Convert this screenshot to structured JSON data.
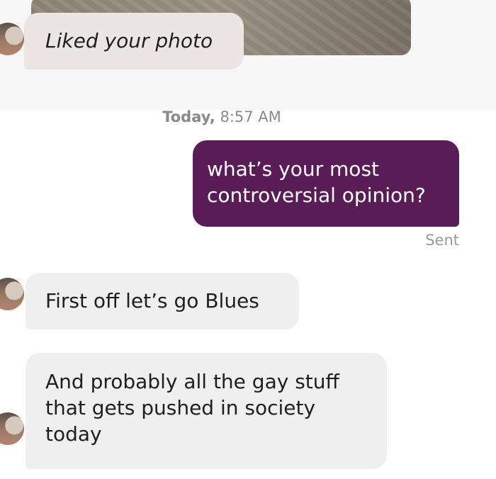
{
  "conversation": {
    "liked_message": "Liked your photo",
    "timestamp": {
      "day": "Today,",
      "time": "8:57 AM"
    },
    "outgoing": {
      "lines": [
        "what’s your most",
        "controversial opinion?"
      ],
      "status": "Sent"
    },
    "incoming": [
      {
        "lines": [
          "First off let’s go Blues"
        ]
      },
      {
        "lines": [
          "And probably all the gay stuff",
          "that gets pushed in society",
          "today"
        ]
      }
    ]
  },
  "colors": {
    "outgoing_bubble": "#5a1c57",
    "incoming_bubble": "#efefef",
    "liked_bubble": "#ebe6e3"
  }
}
